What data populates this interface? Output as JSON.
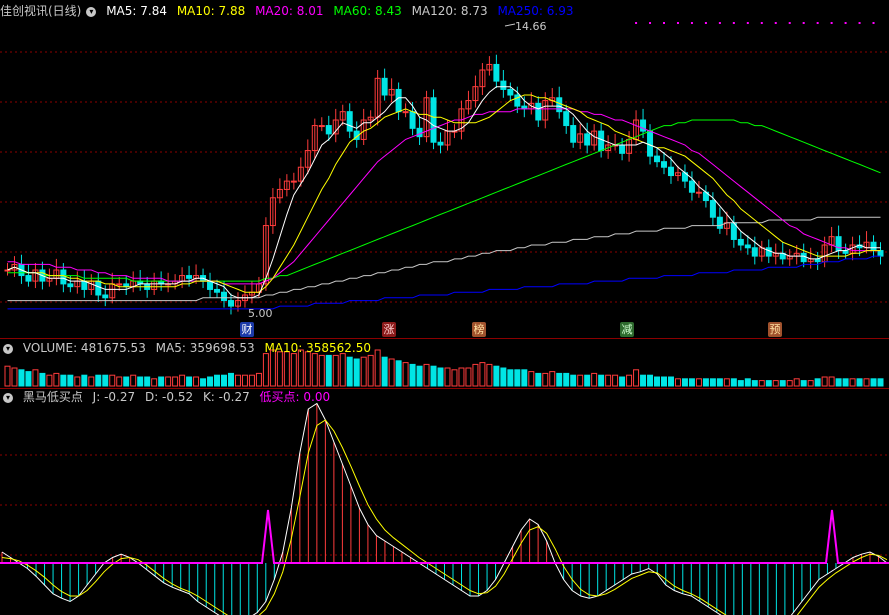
{
  "header": {
    "title": "佳创视讯(日线)",
    "ma": [
      {
        "label": "MA5: 7.84",
        "color": "#ffffff"
      },
      {
        "label": "MA10: 7.88",
        "color": "#ffff00"
      },
      {
        "label": "MA20: 8.01",
        "color": "#ff00ff"
      },
      {
        "label": "MA60: 8.43",
        "color": "#00ff00"
      },
      {
        "label": "MA120: 8.73",
        "color": "#c8c8c8"
      },
      {
        "label": "MA250: 6.93",
        "color": "#0000ff"
      }
    ]
  },
  "signals": [
    "财",
    "涨",
    "榜",
    "减",
    "预"
  ],
  "peak_label": "14.66",
  "low_label": "5.00",
  "volume_header": {
    "volume": "VOLUME: 481675.53",
    "ma5": "MA5: 359698.53",
    "ma10": "MA10: 358562.50"
  },
  "indicator_header": {
    "name": "黑马低买点",
    "j": "J: -0.27",
    "d": "D: -0.52",
    "k": "K: -0.27",
    "buy": "低买点: 0.00"
  },
  "colors": {
    "up": "#ff3c3c",
    "down": "#00e5e5",
    "grid": "#8b0000",
    "pink": "#ff00ff",
    "ma5": "#ffffff",
    "ma10": "#ffff00",
    "ma20": "#ff00ff",
    "ma60": "#00ff00",
    "ma120": "#c8c8c8",
    "ma250": "#0000ff"
  },
  "chart_data": {
    "type": "candlestick",
    "price_range": [
      4.6,
      15.4
    ],
    "close": [
      6.4,
      6.6,
      6.2,
      6.0,
      6.4,
      6.0,
      6.1,
      6.4,
      5.9,
      5.8,
      6.0,
      5.7,
      6.0,
      5.5,
      5.4,
      5.9,
      5.9,
      5.8,
      6.0,
      5.9,
      5.7,
      6.0,
      5.9,
      5.9,
      6.0,
      6.2,
      6.1,
      6.2,
      6.0,
      5.7,
      5.6,
      5.3,
      5.1,
      5.3,
      5.5,
      5.6,
      5.9,
      8.0,
      9.0,
      9.3,
      9.6,
      9.6,
      10.1,
      10.7,
      11.6,
      11.6,
      11.3,
      11.8,
      12.1,
      11.4,
      11.1,
      11.8,
      11.9,
      13.3,
      12.7,
      12.9,
      12.1,
      12.1,
      11.5,
      11.2,
      12.6,
      11.0,
      10.9,
      11.4,
      11.4,
      12.2,
      12.5,
      13.0,
      13.6,
      13.8,
      13.2,
      12.9,
      12.7,
      12.3,
      12.2,
      12.4,
      11.8,
      12.5,
      12.6,
      12.1,
      11.6,
      11.0,
      11.3,
      10.9,
      11.4,
      10.7,
      10.9,
      10.9,
      10.6,
      11.1,
      11.8,
      11.4,
      10.5,
      10.3,
      10.1,
      9.8,
      9.9,
      9.6,
      9.2,
      9.2,
      8.9,
      8.3,
      7.9,
      8.1,
      7.5,
      7.3,
      7.2,
      6.9,
      7.2,
      6.9,
      7.0,
      6.8,
      6.9,
      7.0,
      6.7,
      6.8,
      6.7,
      7.3,
      7.6,
      7.1,
      7.0,
      7.3,
      7.2,
      7.4,
      7.1,
      6.9
    ],
    "ma5": [
      6.4,
      6.5,
      6.4,
      6.3,
      6.3,
      6.2,
      6.1,
      6.1,
      6.1,
      6.0,
      6.0,
      6.0,
      5.9,
      5.8,
      5.7,
      5.7,
      5.7,
      5.7,
      5.8,
      5.9,
      5.9,
      5.9,
      5.9,
      5.9,
      5.9,
      6.0,
      6.0,
      6.1,
      6.1,
      6.0,
      5.9,
      5.8,
      5.5,
      5.4,
      5.4,
      5.4,
      5.5,
      6.1,
      6.8,
      7.6,
      8.4,
      9.1,
      9.5,
      9.9,
      10.4,
      10.9,
      11.1,
      11.4,
      11.7,
      11.6,
      11.5,
      11.7,
      11.7,
      11.9,
      12.1,
      12.4,
      12.6,
      12.6,
      12.3,
      11.9,
      11.8,
      11.6,
      11.5,
      11.4,
      11.4,
      11.5,
      11.7,
      12.1,
      12.5,
      12.8,
      13.0,
      13.0,
      13.0,
      12.8,
      12.5,
      12.3,
      12.2,
      12.3,
      12.3,
      12.3,
      12.2,
      12.0,
      11.7,
      11.4,
      11.2,
      11.1,
      11.0,
      10.9,
      10.9,
      10.9,
      10.9,
      11.0,
      10.9,
      10.8,
      10.6,
      10.4,
      10.1,
      9.9,
      9.7,
      9.4,
      9.2,
      9.0,
      8.7,
      8.4,
      8.1,
      7.8,
      7.6,
      7.4,
      7.2,
      7.1,
      7.0,
      7.0,
      6.9,
      6.9,
      6.9,
      6.8,
      6.8,
      6.9,
      7.0,
      7.1,
      7.1,
      7.2,
      7.3,
      7.2,
      7.2,
      7.2
    ],
    "ma10": [
      6.4,
      6.5,
      6.4,
      6.3,
      6.3,
      6.3,
      6.2,
      6.2,
      6.2,
      6.1,
      6.1,
      6.0,
      6.0,
      6.0,
      5.9,
      5.9,
      5.8,
      5.8,
      5.8,
      5.8,
      5.8,
      5.8,
      5.8,
      5.8,
      5.8,
      5.9,
      5.9,
      6.0,
      6.0,
      6.0,
      6.0,
      5.9,
      5.8,
      5.7,
      5.6,
      5.6,
      5.6,
      5.8,
      6.1,
      6.5,
      6.9,
      7.3,
      7.8,
      8.3,
      8.8,
      9.3,
      9.7,
      10.2,
      10.6,
      11.0,
      11.2,
      11.4,
      11.5,
      11.7,
      11.9,
      12.0,
      12.1,
      12.2,
      12.1,
      12.0,
      12.0,
      11.9,
      11.9,
      11.8,
      11.7,
      11.7,
      11.7,
      11.7,
      11.8,
      11.9,
      12.1,
      12.3,
      12.5,
      12.6,
      12.7,
      12.7,
      12.6,
      12.6,
      12.5,
      12.4,
      12.3,
      12.2,
      12.1,
      11.9,
      11.8,
      11.7,
      11.6,
      11.4,
      11.3,
      11.2,
      11.1,
      11.0,
      10.9,
      10.8,
      10.8,
      10.7,
      10.6,
      10.5,
      10.3,
      10.1,
      9.9,
      9.7,
      9.4,
      9.1,
      8.9,
      8.6,
      8.4,
      8.2,
      8.0,
      7.8,
      7.6,
      7.4,
      7.3,
      7.2,
      7.1,
      7.0,
      6.9,
      6.9,
      6.9,
      6.9,
      6.9,
      7.0,
      7.0,
      7.1,
      7.1,
      7.1
    ],
    "ma20": [
      6.7,
      6.7,
      6.6,
      6.6,
      6.6,
      6.6,
      6.6,
      6.5,
      6.5,
      6.5,
      6.4,
      6.4,
      6.4,
      6.3,
      6.3,
      6.2,
      6.2,
      6.2,
      6.1,
      6.1,
      6.1,
      6.1,
      6.1,
      6.0,
      6.0,
      6.0,
      6.0,
      6.0,
      6.0,
      6.0,
      6.0,
      5.9,
      5.9,
      5.9,
      5.9,
      5.9,
      5.9,
      6.0,
      6.1,
      6.3,
      6.5,
      6.7,
      7.0,
      7.3,
      7.6,
      7.9,
      8.2,
      8.5,
      8.8,
      9.1,
      9.4,
      9.7,
      10.0,
      10.3,
      10.5,
      10.7,
      10.9,
      11.1,
      11.2,
      11.3,
      11.4,
      11.5,
      11.6,
      11.7,
      11.8,
      11.8,
      11.9,
      12.0,
      12.0,
      12.1,
      12.1,
      12.1,
      12.1,
      12.2,
      12.2,
      12.2,
      12.2,
      12.2,
      12.2,
      12.2,
      12.2,
      12.2,
      12.1,
      12.1,
      12.0,
      12.0,
      11.9,
      11.8,
      11.8,
      11.7,
      11.6,
      11.5,
      11.4,
      11.3,
      11.2,
      11.1,
      11.0,
      10.9,
      10.7,
      10.6,
      10.4,
      10.2,
      10.0,
      9.8,
      9.6,
      9.4,
      9.2,
      9.0,
      8.8,
      8.6,
      8.4,
      8.2,
      8.0,
      7.9,
      7.7,
      7.6,
      7.5,
      7.4,
      7.3,
      7.2,
      7.2,
      7.1,
      7.1,
      7.1,
      7.1,
      7.1
    ],
    "ma60": [
      6.3,
      6.3,
      6.3,
      6.3,
      6.3,
      6.2,
      6.2,
      6.2,
      6.2,
      6.2,
      6.2,
      6.1,
      6.1,
      6.1,
      6.1,
      6.1,
      6.1,
      6.1,
      6.0,
      6.0,
      6.0,
      6.0,
      6.0,
      6.0,
      6.0,
      6.0,
      6.0,
      6.0,
      6.0,
      6.0,
      6.0,
      6.0,
      6.0,
      6.0,
      6.0,
      6.0,
      6.0,
      6.1,
      6.1,
      6.2,
      6.2,
      6.3,
      6.4,
      6.5,
      6.6,
      6.7,
      6.8,
      6.9,
      7.0,
      7.1,
      7.2,
      7.3,
      7.4,
      7.5,
      7.6,
      7.7,
      7.8,
      7.9,
      8.0,
      8.1,
      8.2,
      8.3,
      8.4,
      8.5,
      8.6,
      8.7,
      8.8,
      8.9,
      9.0,
      9.1,
      9.2,
      9.3,
      9.4,
      9.5,
      9.6,
      9.7,
      9.8,
      9.9,
      10.0,
      10.1,
      10.2,
      10.3,
      10.4,
      10.5,
      10.6,
      10.7,
      10.8,
      10.9,
      11.0,
      11.1,
      11.2,
      11.3,
      11.4,
      11.5,
      11.6,
      11.6,
      11.7,
      11.7,
      11.8,
      11.8,
      11.8,
      11.8,
      11.8,
      11.8,
      11.8,
      11.7,
      11.7,
      11.6,
      11.6,
      11.5,
      11.4,
      11.3,
      11.2,
      11.1,
      11.0,
      10.9,
      10.8,
      10.7,
      10.6,
      10.5,
      10.4,
      10.3,
      10.2,
      10.1,
      10.0,
      9.9
    ],
    "ma120": [
      5.3,
      5.3,
      5.3,
      5.3,
      5.3,
      5.3,
      5.3,
      5.3,
      5.3,
      5.3,
      5.3,
      5.3,
      5.3,
      5.3,
      5.3,
      5.3,
      5.3,
      5.3,
      5.3,
      5.3,
      5.3,
      5.3,
      5.3,
      5.3,
      5.3,
      5.3,
      5.3,
      5.3,
      5.4,
      5.4,
      5.4,
      5.4,
      5.4,
      5.4,
      5.4,
      5.4,
      5.4,
      5.5,
      5.5,
      5.6,
      5.6,
      5.7,
      5.7,
      5.8,
      5.8,
      5.9,
      5.9,
      6.0,
      6.0,
      6.1,
      6.1,
      6.2,
      6.2,
      6.3,
      6.3,
      6.4,
      6.4,
      6.5,
      6.5,
      6.6,
      6.6,
      6.7,
      6.7,
      6.7,
      6.8,
      6.8,
      6.9,
      6.9,
      7.0,
      7.0,
      7.1,
      7.1,
      7.1,
      7.2,
      7.2,
      7.3,
      7.3,
      7.3,
      7.4,
      7.4,
      7.4,
      7.5,
      7.5,
      7.5,
      7.6,
      7.6,
      7.6,
      7.7,
      7.7,
      7.7,
      7.8,
      7.8,
      7.8,
      7.8,
      7.9,
      7.9,
      7.9,
      7.9,
      8.0,
      8.0,
      8.0,
      8.0,
      8.0,
      8.1,
      8.1,
      8.1,
      8.1,
      8.1,
      8.1,
      8.2,
      8.2,
      8.2,
      8.2,
      8.2,
      8.2,
      8.2,
      8.3,
      8.3,
      8.3,
      8.3,
      8.3,
      8.3,
      8.3,
      8.3,
      8.3,
      8.3
    ],
    "ma250": [
      5.0,
      5.0,
      5.0,
      5.0,
      5.0,
      5.0,
      5.0,
      5.0,
      5.0,
      5.0,
      5.0,
      5.0,
      5.0,
      5.0,
      5.0,
      5.0,
      5.0,
      5.0,
      5.0,
      5.0,
      5.0,
      5.0,
      5.0,
      5.0,
      5.0,
      5.0,
      5.0,
      5.0,
      5.0,
      5.0,
      5.0,
      5.0,
      5.0,
      5.0,
      5.0,
      5.0,
      5.0,
      5.0,
      5.0,
      5.1,
      5.1,
      5.1,
      5.1,
      5.1,
      5.2,
      5.2,
      5.2,
      5.2,
      5.2,
      5.3,
      5.3,
      5.3,
      5.3,
      5.3,
      5.4,
      5.4,
      5.4,
      5.4,
      5.4,
      5.5,
      5.5,
      5.5,
      5.5,
      5.5,
      5.6,
      5.6,
      5.6,
      5.6,
      5.6,
      5.7,
      5.7,
      5.7,
      5.7,
      5.7,
      5.8,
      5.8,
      5.8,
      5.8,
      5.8,
      5.9,
      5.9,
      5.9,
      5.9,
      5.9,
      6.0,
      6.0,
      6.0,
      6.0,
      6.0,
      6.1,
      6.1,
      6.1,
      6.1,
      6.1,
      6.2,
      6.2,
      6.2,
      6.2,
      6.2,
      6.3,
      6.3,
      6.3,
      6.3,
      6.3,
      6.4,
      6.4,
      6.4,
      6.4,
      6.4,
      6.5,
      6.5,
      6.5,
      6.5,
      6.5,
      6.6,
      6.6,
      6.6,
      6.7,
      6.7,
      6.7,
      6.8,
      6.8,
      6.8,
      6.8,
      6.9,
      6.9
    ],
    "volume_rel": [
      0.55,
      0.5,
      0.45,
      0.4,
      0.45,
      0.35,
      0.3,
      0.35,
      0.3,
      0.3,
      0.25,
      0.3,
      0.25,
      0.3,
      0.3,
      0.3,
      0.25,
      0.25,
      0.3,
      0.25,
      0.25,
      0.2,
      0.25,
      0.25,
      0.25,
      0.3,
      0.25,
      0.25,
      0.2,
      0.25,
      0.3,
      0.3,
      0.35,
      0.3,
      0.3,
      0.3,
      0.35,
      0.9,
      1.0,
      0.95,
      0.95,
      0.9,
      1.0,
      0.95,
      0.9,
      0.85,
      0.85,
      0.85,
      0.9,
      0.8,
      0.75,
      0.8,
      0.85,
      1.0,
      0.8,
      0.75,
      0.7,
      0.65,
      0.6,
      0.55,
      0.6,
      0.55,
      0.5,
      0.5,
      0.45,
      0.5,
      0.5,
      0.6,
      0.65,
      0.6,
      0.55,
      0.5,
      0.45,
      0.45,
      0.45,
      0.4,
      0.35,
      0.35,
      0.4,
      0.35,
      0.35,
      0.3,
      0.3,
      0.3,
      0.35,
      0.3,
      0.3,
      0.3,
      0.25,
      0.3,
      0.45,
      0.3,
      0.3,
      0.25,
      0.25,
      0.25,
      0.2,
      0.2,
      0.2,
      0.2,
      0.2,
      0.2,
      0.2,
      0.2,
      0.2,
      0.15,
      0.2,
      0.15,
      0.15,
      0.15,
      0.15,
      0.15,
      0.15,
      0.2,
      0.15,
      0.15,
      0.2,
      0.25,
      0.25,
      0.2,
      0.2,
      0.2,
      0.2,
      0.2,
      0.2,
      0.2
    ],
    "kdj_j": [
      0.1,
      0.05,
      0.0,
      -0.05,
      -0.12,
      -0.2,
      -0.28,
      -0.32,
      -0.35,
      -0.3,
      -0.2,
      -0.1,
      0.0,
      0.05,
      0.08,
      0.05,
      0.0,
      -0.06,
      -0.12,
      -0.18,
      -0.22,
      -0.25,
      -0.28,
      -0.35,
      -0.4,
      -0.45,
      -0.5,
      -0.55,
      -0.55,
      -0.5,
      -0.45,
      -0.35,
      -0.15,
      0.1,
      0.5,
      1.0,
      1.4,
      1.45,
      1.3,
      1.1,
      0.9,
      0.7,
      0.5,
      0.35,
      0.25,
      0.2,
      0.15,
      0.1,
      0.05,
      0.0,
      -0.05,
      -0.1,
      -0.15,
      -0.2,
      -0.25,
      -0.3,
      -0.3,
      -0.25,
      -0.15,
      0.0,
      0.15,
      0.3,
      0.4,
      0.35,
      0.2,
      0.0,
      -0.15,
      -0.25,
      -0.3,
      -0.32,
      -0.3,
      -0.25,
      -0.2,
      -0.15,
      -0.1,
      -0.08,
      -0.05,
      -0.1,
      -0.2,
      -0.25,
      -0.28,
      -0.3,
      -0.35,
      -0.4,
      -0.45,
      -0.5,
      -0.55,
      -0.6,
      -0.65,
      -0.7,
      -0.7,
      -0.65,
      -0.55,
      -0.45,
      -0.35,
      -0.25,
      -0.15,
      -0.1,
      -0.05,
      0.0,
      0.05,
      0.08,
      0.1,
      0.06,
      0.0
    ],
    "kdj_d": [
      0.05,
      0.04,
      0.02,
      -0.02,
      -0.07,
      -0.13,
      -0.2,
      -0.26,
      -0.3,
      -0.3,
      -0.25,
      -0.17,
      -0.08,
      -0.01,
      0.04,
      0.05,
      0.03,
      -0.02,
      -0.08,
      -0.14,
      -0.19,
      -0.23,
      -0.26,
      -0.3,
      -0.35,
      -0.4,
      -0.45,
      -0.5,
      -0.53,
      -0.52,
      -0.49,
      -0.42,
      -0.28,
      -0.08,
      0.22,
      0.6,
      1.0,
      1.25,
      1.3,
      1.2,
      1.05,
      0.88,
      0.7,
      0.53,
      0.4,
      0.3,
      0.23,
      0.17,
      0.11,
      0.05,
      0.0,
      -0.05,
      -0.1,
      -0.15,
      -0.2,
      -0.25,
      -0.28,
      -0.27,
      -0.21,
      -0.1,
      0.04,
      0.18,
      0.3,
      0.33,
      0.27,
      0.13,
      -0.03,
      -0.15,
      -0.24,
      -0.29,
      -0.3,
      -0.28,
      -0.24,
      -0.19,
      -0.14,
      -0.11,
      -0.08,
      -0.09,
      -0.15,
      -0.21,
      -0.25,
      -0.28,
      -0.32,
      -0.37,
      -0.42,
      -0.47,
      -0.52,
      -0.57,
      -0.62,
      -0.66,
      -0.68,
      -0.67,
      -0.6,
      -0.52,
      -0.42,
      -0.32,
      -0.22,
      -0.15,
      -0.09,
      -0.04,
      0.01,
      0.05,
      0.08,
      0.07,
      0.03
    ]
  }
}
